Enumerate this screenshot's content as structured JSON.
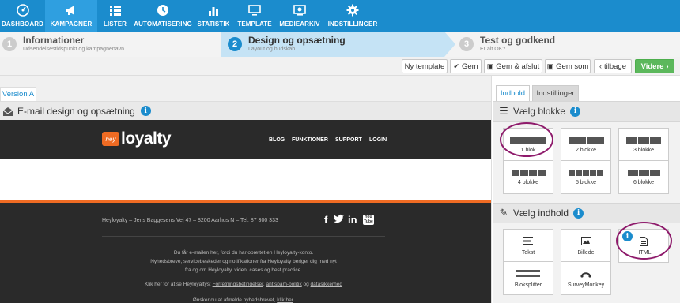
{
  "nav": {
    "items": [
      {
        "label": "DASHBOARD",
        "icon": "dashboard-icon",
        "active": false
      },
      {
        "label": "KAMPAGNER",
        "icon": "megaphone-icon",
        "active": true
      },
      {
        "label": "LISTER",
        "icon": "list-icon",
        "active": false
      },
      {
        "label": "AUTOMATISERING",
        "icon": "clock-icon",
        "active": false
      },
      {
        "label": "STATISTIK",
        "icon": "bar-chart-icon",
        "active": false
      },
      {
        "label": "TEMPLATE",
        "icon": "monitor-icon",
        "active": false
      },
      {
        "label": "MEDIEARKIV",
        "icon": "media-icon",
        "active": false
      },
      {
        "label": "INDSTILLINGER",
        "icon": "gear-icon",
        "active": false
      }
    ]
  },
  "steps": [
    {
      "num": "1",
      "title": "Informationer",
      "subtitle": "Udsendelsestidspunkt og kampagnenavn"
    },
    {
      "num": "2",
      "title": "Design og opsætning",
      "subtitle": "Layout og budskab"
    },
    {
      "num": "3",
      "title": "Test og godkend",
      "subtitle": "Er alt OK?"
    }
  ],
  "toolbar": {
    "new_template": "Ny template",
    "save": "Gem",
    "save_close": "Gem & afslut",
    "save_as": "Gem som",
    "back": "tilbage",
    "next": "Videre"
  },
  "editor": {
    "version_tab": "Version A",
    "title": "E-mail design og opsætning",
    "info": "i"
  },
  "email": {
    "logo_mark": "hey",
    "logo_text": "loyalty",
    "nav": [
      "BLOG",
      "FUNKTIONER",
      "SUPPORT",
      "LOGIN"
    ],
    "address": "Heyloyalty – Jens Baggesens Vej 47 – 8200 Aarhus N – Tel. 87 300 333",
    "social": [
      "f",
      "t",
      "in",
      "You Tube"
    ],
    "footer_line1": "Du får e-mailen her, fordi du har oprettet en Heyloyalty-konto.",
    "footer_line2": "Nyhedsbreve, servicebeskeder og notifikationer fra Heyloyalty beriger dig med nyt",
    "footer_line3": "fra og om Heyloyalty, viden, cases og best practice.",
    "footer_line4_pre": "Klik her for at se Heyloyaltys: ",
    "footer_link1": "Forretningsbetingelser",
    "footer_link2": "antispam-politik",
    "footer_link3_pre": " og ",
    "footer_link3": "datasikkerhed",
    "footer_line5_pre": "Ønsker du at afmelde nyhedsbrevet, ",
    "footer_line5_link": "klik her",
    "footer_line5_post": "."
  },
  "panel": {
    "tab_content": "Indhold",
    "tab_settings": "Indstillinger",
    "blocks_title": "Vælg blokke",
    "content_title": "Vælg indhold",
    "blocks": [
      {
        "label": "1 blok",
        "count": 1
      },
      {
        "label": "2 blokke",
        "count": 2
      },
      {
        "label": "3 blokke",
        "count": 3
      },
      {
        "label": "4 blokke",
        "count": 4
      },
      {
        "label": "5 blokke",
        "count": 5
      },
      {
        "label": "6 blokke",
        "count": 6
      }
    ],
    "content_items": [
      {
        "label": "Tekst",
        "icon": "text-icon"
      },
      {
        "label": "Billede",
        "icon": "image-icon"
      },
      {
        "label": "HTML",
        "icon": "file-icon"
      },
      {
        "label": "Bloksplitter",
        "icon": "splitter-icon"
      },
      {
        "label": "SurveyMonkey",
        "icon": "surveymonkey-icon"
      }
    ]
  },
  "colors": {
    "nav_blue": "#1b8ccd",
    "accent_orange": "#ef6b23",
    "highlight_circle": "#8e1a6b",
    "next_green": "#5cb85c"
  }
}
